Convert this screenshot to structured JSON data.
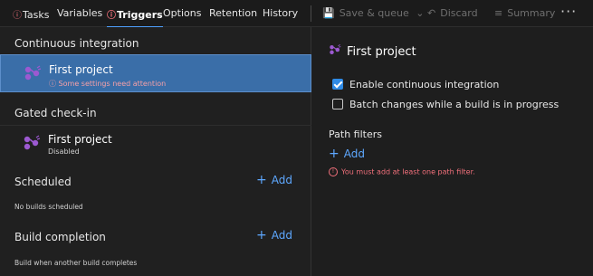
{
  "tabs": [
    {
      "label": "Tasks",
      "error": true,
      "active": false
    },
    {
      "label": "Variables",
      "error": false,
      "active": false
    },
    {
      "label": "Triggers",
      "error": true,
      "active": true
    },
    {
      "label": "Options",
      "error": false,
      "active": false
    },
    {
      "label": "Retention",
      "error": false,
      "active": false
    },
    {
      "label": "History",
      "error": false,
      "active": false
    }
  ],
  "toolbar": {
    "save_label": "Save & queue",
    "discard_label": "Discard",
    "summary_label": "Summary",
    "more_label": "···"
  },
  "left": {
    "ci_header": "Continuous integration",
    "ci_item": {
      "title": "First project",
      "warning": "Some settings need attention"
    },
    "gated_header": "Gated check-in",
    "gated_item": {
      "title": "First project",
      "status": "Disabled"
    },
    "scheduled_header": "Scheduled",
    "scheduled_add": "Add",
    "scheduled_note": "No builds scheduled",
    "build_header": "Build completion",
    "build_add": "Add",
    "build_note": "Build when another build completes"
  },
  "right": {
    "title": "First project",
    "enable_ci": {
      "label": "Enable continuous integration",
      "checked": true
    },
    "batch": {
      "label": "Batch changes while a build is in progress",
      "checked": false
    },
    "path_filters_header": "Path filters",
    "add_label": "Add",
    "error": "You must add at least one path filter."
  },
  "colors": {
    "accent": "#4ea1ff",
    "error": "#f1707b",
    "selected": "#3a6ea8",
    "icon": "#9c59d1"
  }
}
